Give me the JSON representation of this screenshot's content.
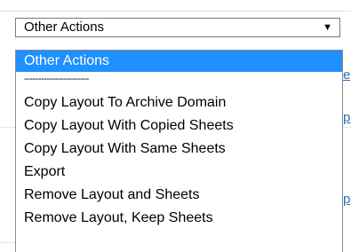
{
  "select": {
    "value": "Other Actions",
    "arrow": "▼",
    "options": [
      {
        "label": "Other Actions",
        "selected": true
      },
      {
        "label": "-----------------------",
        "separator": true
      },
      {
        "label": "Copy Layout To Archive Domain"
      },
      {
        "label": "Copy Layout With Copied Sheets"
      },
      {
        "label": "Copy Layout With Same Sheets"
      },
      {
        "label": "Export"
      },
      {
        "label": "Remove Layout and Sheets"
      },
      {
        "label": "Remove Layout, Keep Sheets"
      }
    ]
  },
  "background": {
    "link_fragments": [
      "e",
      "p",
      "p"
    ]
  },
  "colors": {
    "selected_bg": "#1e90ff",
    "selected_text": "#ffffff",
    "link": "#2a6fb5"
  }
}
